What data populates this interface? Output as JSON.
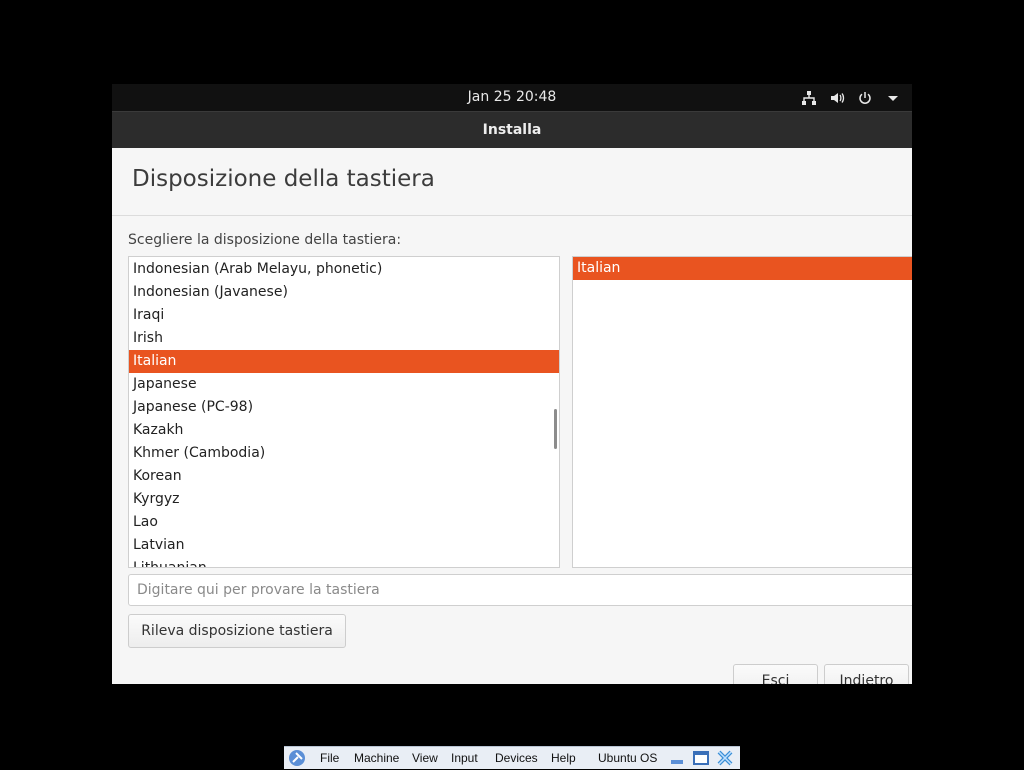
{
  "top_bar": {
    "clock": "Jan 25  20:48"
  },
  "window": {
    "title": "Installa"
  },
  "page": {
    "title": "Disposizione della tastiera",
    "prompt": "Scegliere la disposizione della tastiera:"
  },
  "layouts": {
    "items": [
      "Indonesian (Arab Melayu, phonetic)",
      "Indonesian (Javanese)",
      "Iraqi",
      "Irish",
      "Italian",
      "Japanese",
      "Japanese (PC-98)",
      "Kazakh",
      "Khmer (Cambodia)",
      "Korean",
      "Kyrgyz",
      "Lao",
      "Latvian",
      "Lithuanian"
    ],
    "selected": "Italian"
  },
  "variants": {
    "items": [
      "Italian"
    ],
    "selected": "Italian"
  },
  "test_input": {
    "placeholder": "Digitare qui per provare la tastiera",
    "value": ""
  },
  "buttons": {
    "detect": "Rileva disposizione tastiera",
    "quit": "Esci",
    "back": "Indietro"
  },
  "vbox_menu": {
    "file": "File",
    "machine": "Machine",
    "view": "View",
    "input": "Input",
    "devices": "Devices",
    "help": "Help",
    "os_name": "Ubuntu OS"
  },
  "icons": {
    "network": "network-icon",
    "volume": "volume-icon",
    "power": "power-icon",
    "menu": "chevron-down-icon"
  },
  "colors": {
    "accent": "#e95420",
    "titlebar": "#2c2c2c",
    "topbar": "#111111"
  }
}
